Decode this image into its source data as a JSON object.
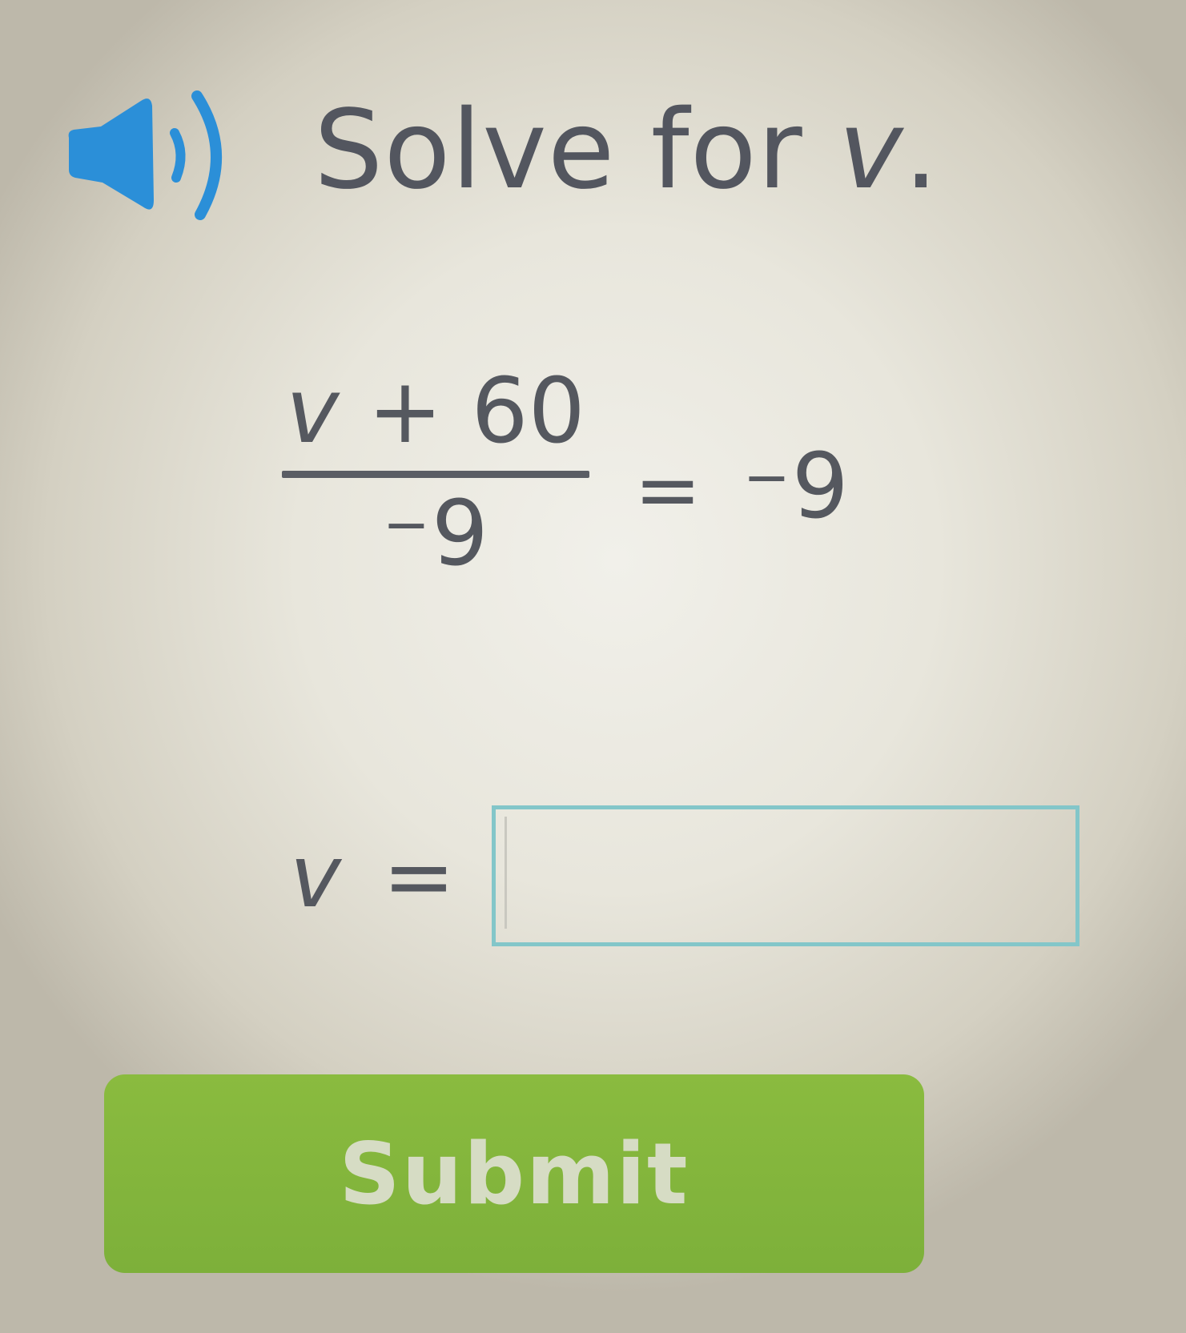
{
  "question": {
    "prompt_prefix": "Solve for ",
    "prompt_var": "v",
    "prompt_suffix": "."
  },
  "equation": {
    "numerator_var": "v",
    "numerator_rest": " + 60",
    "denominator_sign": "−",
    "denominator_value": "9",
    "equals": "=",
    "rhs_sign": "−",
    "rhs_value": "9"
  },
  "answer": {
    "label_var": "v",
    "label_eq": "=",
    "value": ""
  },
  "submit": {
    "label": "Submit"
  },
  "colors": {
    "speaker": "#2b8fd8",
    "input_border": "#83c6c9",
    "submit_bg": "#86b83d"
  },
  "icons": {
    "speaker": "speaker-icon"
  }
}
